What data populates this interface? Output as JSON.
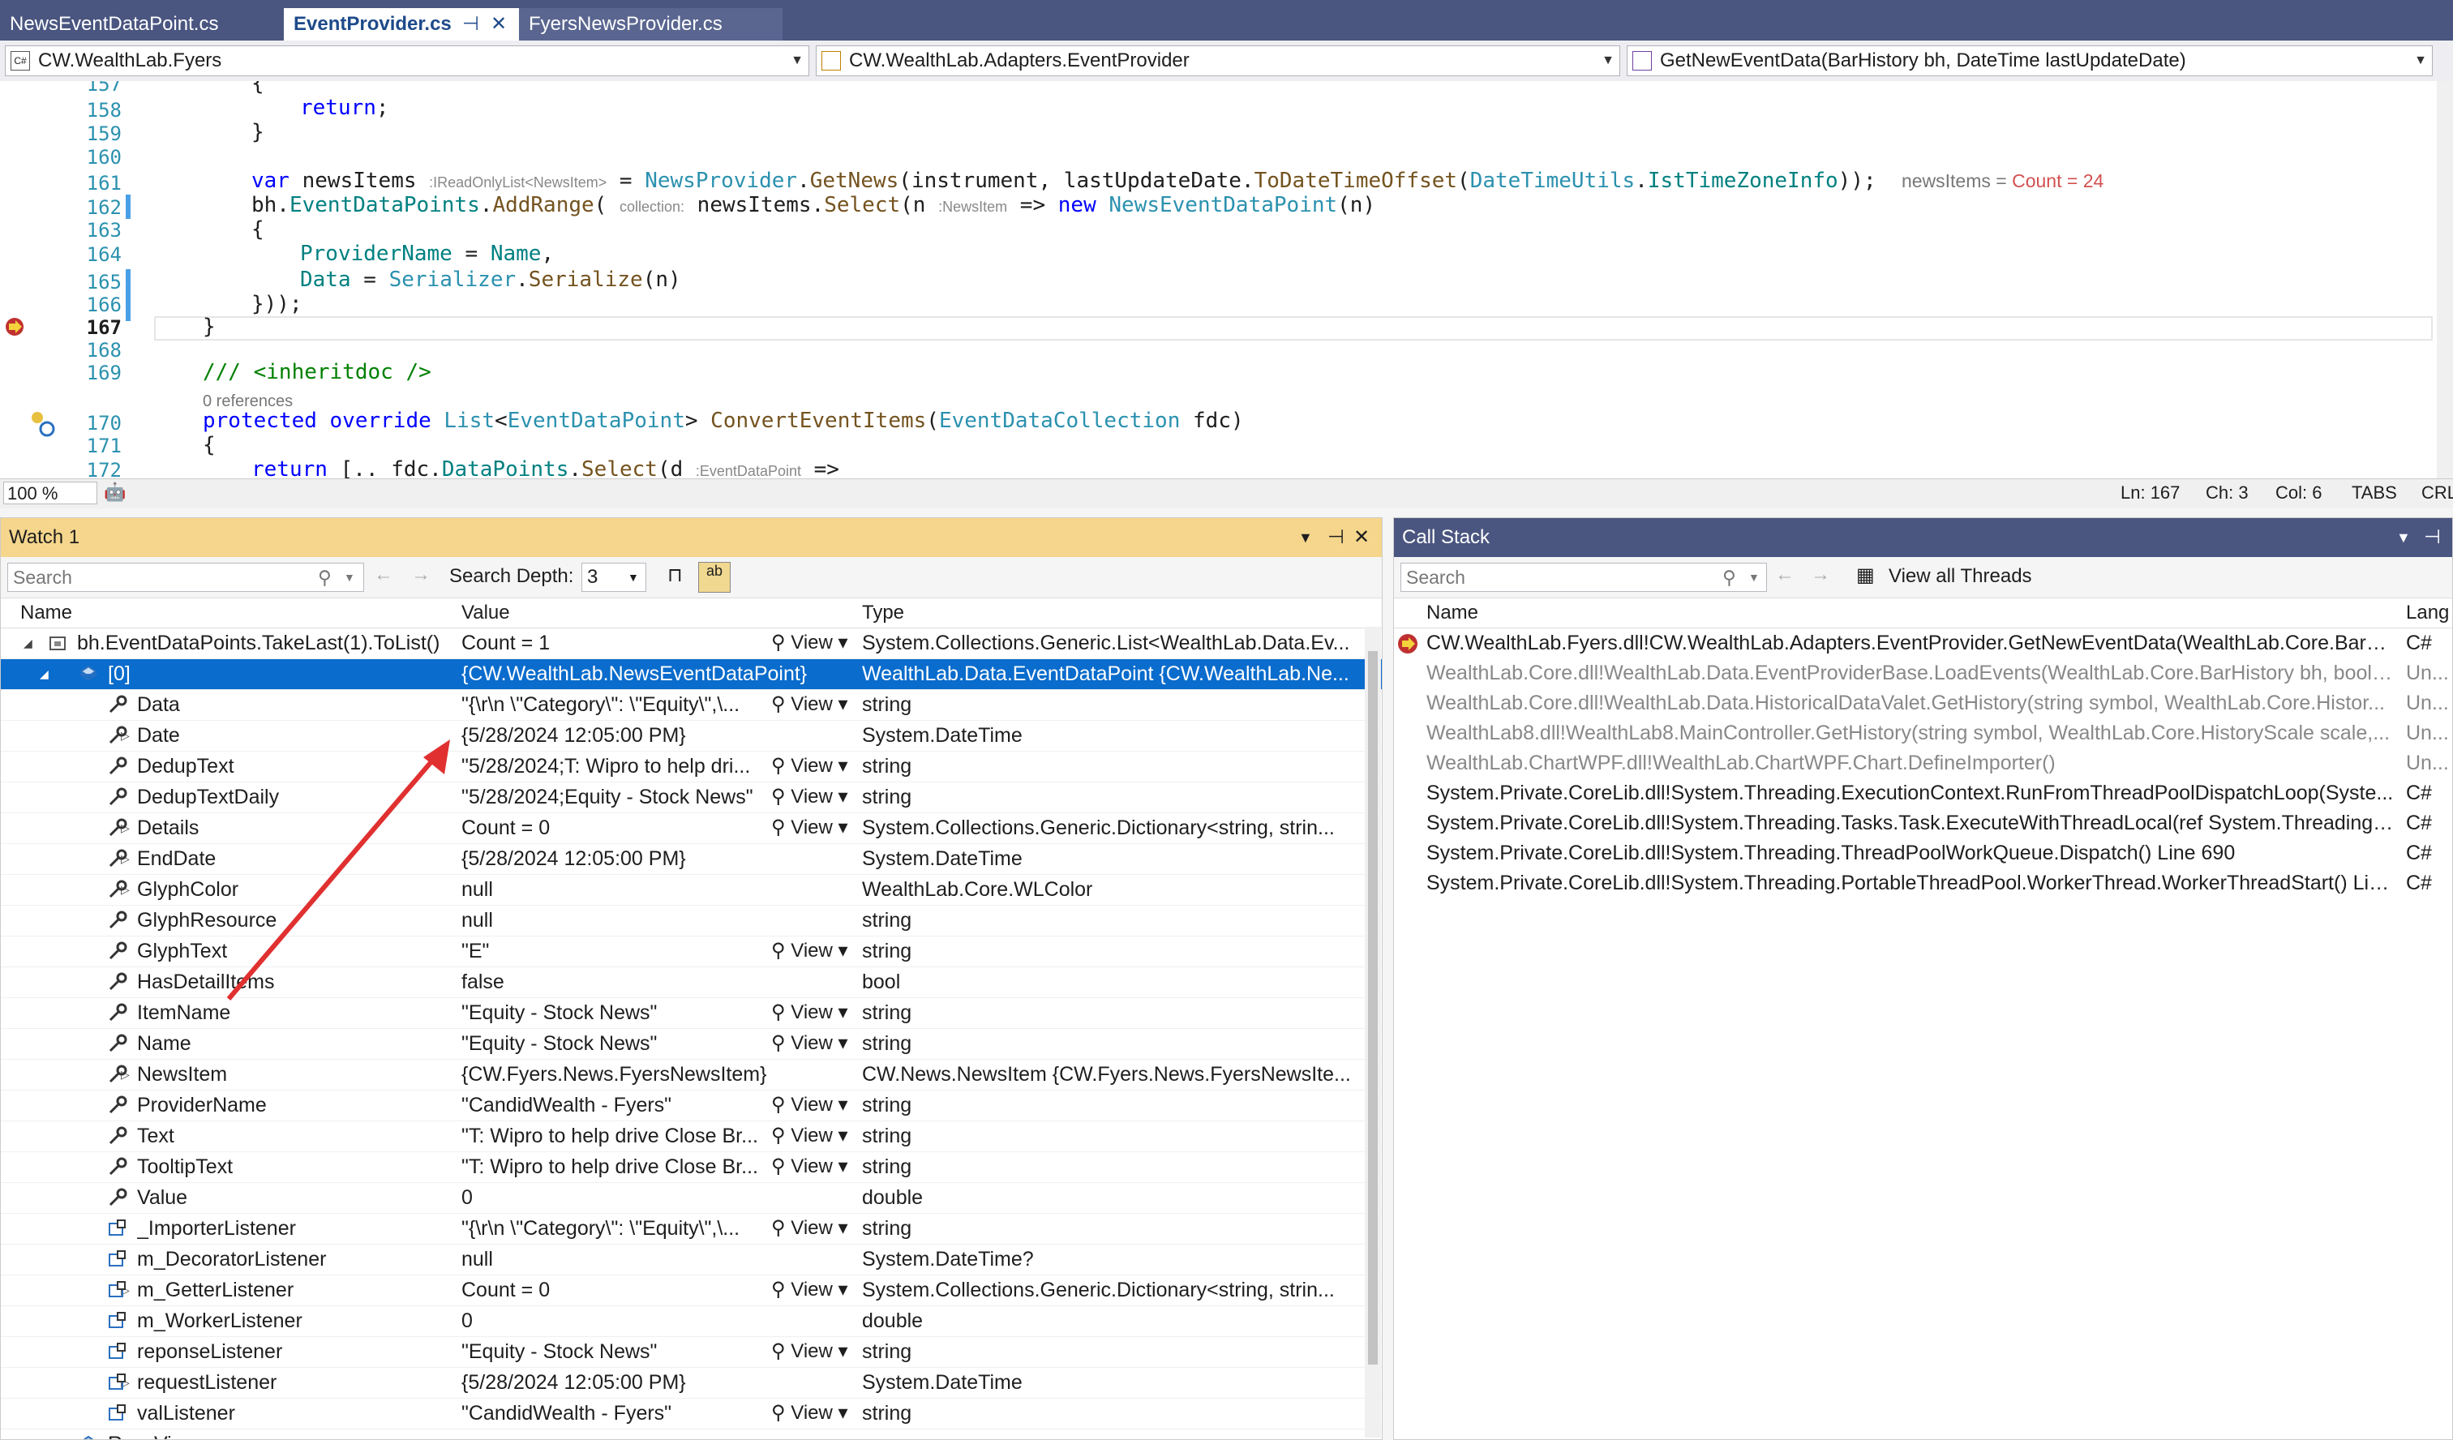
{
  "tabs": [
    {
      "label": "NewsEventDataPoint.cs",
      "active": false
    },
    {
      "label": "EventProvider.cs",
      "active": true
    },
    {
      "label": "FyersNewsProvider.cs",
      "active": false
    }
  ],
  "tab_pin": "⊣",
  "tab_close": "✕",
  "nav": {
    "project": "CW.WealthLab.Fyers",
    "type": "CW.WealthLab.Adapters.EventProvider",
    "member": "GetNewEventData(BarHistory bh, DateTime lastUpdateDate)"
  },
  "editor": {
    "line_numbers": [
      "157",
      "158",
      "159",
      "160",
      "161",
      "162",
      "163",
      "164",
      "165",
      "166",
      "167",
      "168",
      "169",
      "170",
      "171",
      "172"
    ],
    "current_line": "167",
    "references": "0 references",
    "datatip_name": "newsItems",
    "datatip_eq": " = ",
    "datatip_value": "Count = 24",
    "hint_ireadonly": ":IReadOnlyList<NewsItem>",
    "hint_collection": "collection:",
    "hint_newsitem": ":NewsItem",
    "hint_eventdatapoint": ":EventDataPoint"
  },
  "edit_status": {
    "zoom": "100 %",
    "ln": "Ln: 167",
    "ch": "Ch: 3",
    "col": "Col: 6",
    "tabs": "TABS",
    "eol": "CRL"
  },
  "watch": {
    "title": "Watch 1",
    "search_placeholder": "Search",
    "search_depth_label": "Search Depth:",
    "search_depth": "3",
    "col_name": "Name",
    "col_value": "Value",
    "col_type": "Type",
    "view_label": "View",
    "rows": [
      {
        "name": "bh.EventDataPoints.TakeLast(1).ToList()",
        "value": "Count = 1",
        "type": "System.Collections.Generic.List<WealthLab.Data.Ev...",
        "indent": 0,
        "expander": "open",
        "icon": "object",
        "view": true
      },
      {
        "name": "[0]",
        "value": "{CW.WealthLab.NewsEventDataPoint}",
        "type": "WealthLab.Data.EventDataPoint {CW.WealthLab.Ne...",
        "indent": 1,
        "expander": "open",
        "icon": "field",
        "view": false,
        "selected": true
      },
      {
        "name": "Data",
        "value": "\"{\\r\\n  \\\"Category\\\": \\\"Equity\\\",\\...",
        "type": "string",
        "indent": 2,
        "expander": "",
        "icon": "wrench",
        "view": true
      },
      {
        "name": "Date",
        "value": "{5/28/2024 12:05:00 PM}",
        "type": "System.DateTime",
        "indent": 2,
        "expander": "closed",
        "icon": "wrench",
        "view": false
      },
      {
        "name": "DedupText",
        "value": "\"5/28/2024;T: Wipro to help dri...",
        "type": "string",
        "indent": 2,
        "expander": "",
        "icon": "wrench",
        "view": true
      },
      {
        "name": "DedupTextDaily",
        "value": "\"5/28/2024;Equity - Stock News\"",
        "type": "string",
        "indent": 2,
        "expander": "",
        "icon": "wrench",
        "view": true
      },
      {
        "name": "Details",
        "value": "Count = 0",
        "type": "System.Collections.Generic.Dictionary<string, strin...",
        "indent": 2,
        "expander": "closed",
        "icon": "wrench",
        "view": true
      },
      {
        "name": "EndDate",
        "value": "{5/28/2024 12:05:00 PM}",
        "type": "System.DateTime",
        "indent": 2,
        "expander": "closed",
        "icon": "wrench",
        "view": false
      },
      {
        "name": "GlyphColor",
        "value": "null",
        "type": "WealthLab.Core.WLColor",
        "indent": 2,
        "expander": "closed",
        "icon": "wrench",
        "view": false
      },
      {
        "name": "GlyphResource",
        "value": "null",
        "type": "string",
        "indent": 2,
        "expander": "",
        "icon": "wrench",
        "view": false
      },
      {
        "name": "GlyphText",
        "value": "\"E\"",
        "type": "string",
        "indent": 2,
        "expander": "",
        "icon": "wrench",
        "view": true
      },
      {
        "name": "HasDetailItems",
        "value": "false",
        "type": "bool",
        "indent": 2,
        "expander": "",
        "icon": "wrench",
        "view": false
      },
      {
        "name": "ItemName",
        "value": "\"Equity - Stock News\"",
        "type": "string",
        "indent": 2,
        "expander": "",
        "icon": "wrench",
        "view": true
      },
      {
        "name": "Name",
        "value": "\"Equity - Stock News\"",
        "type": "string",
        "indent": 2,
        "expander": "",
        "icon": "wrench",
        "view": true
      },
      {
        "name": "NewsItem",
        "value": "{CW.Fyers.News.FyersNewsItem}",
        "type": "CW.News.NewsItem {CW.Fyers.News.FyersNewsIte...",
        "indent": 2,
        "expander": "closed",
        "icon": "wrench",
        "view": false
      },
      {
        "name": "ProviderName",
        "value": "\"CandidWealth - Fyers\"",
        "type": "string",
        "indent": 2,
        "expander": "",
        "icon": "wrench",
        "view": true
      },
      {
        "name": "Text",
        "value": "\"T: Wipro to help drive Close Br...",
        "type": "string",
        "indent": 2,
        "expander": "",
        "icon": "wrench",
        "view": true
      },
      {
        "name": "TooltipText",
        "value": "\"T: Wipro to help drive Close Br...",
        "type": "string",
        "indent": 2,
        "expander": "",
        "icon": "wrench",
        "view": true
      },
      {
        "name": "Value",
        "value": "0",
        "type": "double",
        "indent": 2,
        "expander": "",
        "icon": "wrench",
        "view": false
      },
      {
        "name": "_ImporterListener",
        "value": "\"{\\r\\n  \\\"Category\\\": \\\"Equity\\\",\\...",
        "type": "string",
        "indent": 2,
        "expander": "",
        "icon": "private",
        "view": true
      },
      {
        "name": "m_DecoratorListener",
        "value": "null",
        "type": "System.DateTime?",
        "indent": 2,
        "expander": "",
        "icon": "private",
        "view": false
      },
      {
        "name": "m_GetterListener",
        "value": "Count = 0",
        "type": "System.Collections.Generic.Dictionary<string, strin...",
        "indent": 2,
        "expander": "closed",
        "icon": "private",
        "view": true
      },
      {
        "name": "m_WorkerListener",
        "value": "0",
        "type": "double",
        "indent": 2,
        "expander": "",
        "icon": "private",
        "view": false
      },
      {
        "name": "reponseListener",
        "value": "\"Equity - Stock News\"",
        "type": "string",
        "indent": 2,
        "expander": "",
        "icon": "private",
        "view": true
      },
      {
        "name": "requestListener",
        "value": "{5/28/2024 12:05:00 PM}",
        "type": "System.DateTime",
        "indent": 2,
        "expander": "closed",
        "icon": "private",
        "view": false
      },
      {
        "name": "valListener",
        "value": "\"CandidWealth - Fyers\"",
        "type": "string",
        "indent": 2,
        "expander": "",
        "icon": "private",
        "view": true
      },
      {
        "name": "Raw View",
        "value": "",
        "type": "",
        "indent": 1,
        "expander": "closed",
        "icon": "field",
        "view": false
      }
    ]
  },
  "callstack": {
    "title": "Call Stack",
    "search_placeholder": "Search",
    "view_all_threads": "View all Threads",
    "col_name": "Name",
    "col_lang": "Lang",
    "frames": [
      {
        "name": "CW.WealthLab.Fyers.dll!CW.WealthLab.Adapters.EventProvider.GetNewEventData(WealthLab.Core.BarHi...",
        "lang": "C#",
        "dim": false,
        "current": true
      },
      {
        "name": "WealthLab.Core.dll!WealthLab.Data.EventProviderBase.LoadEvents(WealthLab.Core.BarHistory bh, bool o...",
        "lang": "Un...",
        "dim": true,
        "current": false
      },
      {
        "name": "WealthLab.Core.dll!WealthLab.Data.HistoricalDataValet.GetHistory(string symbol, WealthLab.Core.Histor...",
        "lang": "Un...",
        "dim": true,
        "current": false
      },
      {
        "name": "WealthLab8.dll!WealthLab8.MainController.GetHistory(string symbol, WealthLab.Core.HistoryScale scale,...",
        "lang": "Un...",
        "dim": true,
        "current": false
      },
      {
        "name": "WealthLab.ChartWPF.dll!WealthLab.ChartWPF.Chart.DefineImporter()",
        "lang": "Un...",
        "dim": true,
        "current": false
      },
      {
        "name": "System.Private.CoreLib.dll!System.Threading.ExecutionContext.RunFromThreadPoolDispatchLoop(Syste...",
        "lang": "C#",
        "dim": false,
        "current": false
      },
      {
        "name": "System.Private.CoreLib.dll!System.Threading.Tasks.Task.ExecuteWithThreadLocal(ref System.Threading.T...",
        "lang": "C#",
        "dim": false,
        "current": false
      },
      {
        "name": "System.Private.CoreLib.dll!System.Threading.ThreadPoolWorkQueue.Dispatch() Line 690",
        "lang": "C#",
        "dim": false,
        "current": false
      },
      {
        "name": "System.Private.CoreLib.dll!System.Threading.PortableThreadPool.WorkerThread.WorkerThreadStart() Lin...",
        "lang": "C#",
        "dim": false,
        "current": false
      }
    ]
  },
  "colors": {
    "tab_strip": "#4a5680",
    "panel_header_active": "#f5d68c",
    "panel_header_inactive": "#4a5680",
    "selection": "#0a6ccc",
    "arrow": "#e03030"
  }
}
